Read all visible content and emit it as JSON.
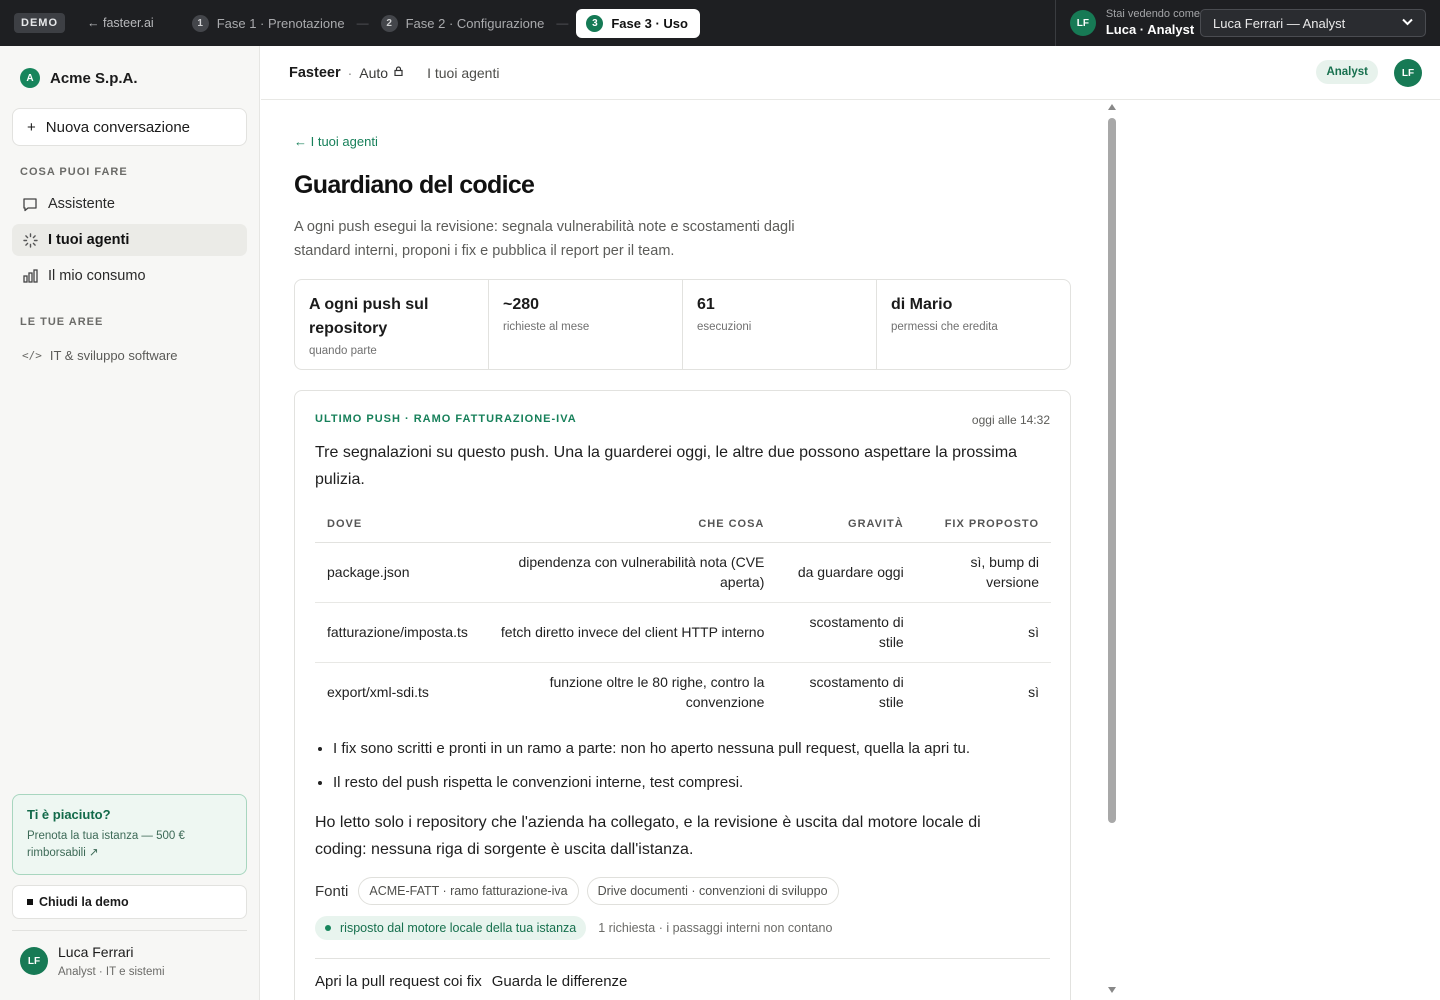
{
  "topbar": {
    "demo_badge": "DEMO",
    "back_link": "← fasteer.ai",
    "steps": [
      {
        "num": "1",
        "label": "Fase 1 · Prenotazione"
      },
      {
        "num": "2",
        "label": "Fase 2 · Configurazione"
      },
      {
        "num": "3",
        "label": "Fase 3 · Uso"
      }
    ],
    "separator": "—",
    "viewing_avatar": "LF",
    "viewing_line1": "Stai vedendo come",
    "viewing_line2": "Luca · Analyst",
    "user_select_value": "Luca Ferrari — Analyst"
  },
  "sidebar": {
    "org_initial": "A",
    "org_name": "Acme S.p.A.",
    "new_conversation": "Nuova conversazione",
    "section_what": "COSA PUOI FARE",
    "items": [
      {
        "label": "Assistente"
      },
      {
        "label": "I tuoi agenti"
      },
      {
        "label": "Il mio consumo"
      }
    ],
    "section_areas": "LE TUE AREE",
    "area_code": "</>",
    "area_label": "IT & sviluppo software",
    "promo_title": "Ti è piaciuto?",
    "promo_text": "Prenota la tua istanza — 500 € rimborsabili ↗",
    "close_demo": "Chiudi la demo",
    "user_initials": "LF",
    "user_name": "Luca Ferrari",
    "user_role": "Analyst · IT e sistemi"
  },
  "header": {
    "brand": "Fasteer",
    "dot": "·",
    "mode": "Auto",
    "link": "I tuoi agenti",
    "role_pill": "Analyst",
    "avatar": "LF"
  },
  "agent": {
    "back": "← I tuoi agenti",
    "title": "Guardiano del codice",
    "description": "A ogni push esegui la revisione: segnala vulnerabilità note e scostamenti dagli standard interni, proponi i fix e pubblica il report per il team.",
    "stats": [
      {
        "value": "A ogni push sul repository",
        "label": "quando parte"
      },
      {
        "value": "~280",
        "label": "richieste al mese"
      },
      {
        "value": "61",
        "label": "esecuzioni"
      },
      {
        "value": "di Mario",
        "label": "permessi che eredita"
      }
    ]
  },
  "report": {
    "label": "ULTIMO PUSH · RAMO FATTURAZIONE-IVA",
    "time": "oggi alle 14:32",
    "lead": "Tre segnalazioni su questo push. Una la guarderei oggi, le altre due possono aspettare la prossima pulizia.",
    "columns": [
      "DOVE",
      "CHE COSA",
      "GRAVITÀ",
      "FIX PROPOSTO"
    ],
    "rows": [
      [
        "package.json",
        "dipendenza con vulnerabilità nota (CVE aperta)",
        "da guardare oggi",
        "sì, bump di versione"
      ],
      [
        "fatturazione/imposta.ts",
        "fetch diretto invece del client HTTP interno",
        "scostamento di stile",
        "sì"
      ],
      [
        "export/xml-sdi.ts",
        "funzione oltre le 80 righe, contro la convenzione",
        "scostamento di stile",
        "sì"
      ]
    ],
    "bullets": [
      "I fix sono scritti e pronti in un ramo a parte: non ho aperto nessuna pull request, quella la apri tu.",
      "Il resto del push rispetta le convenzioni interne, test compresi."
    ],
    "note": "Ho letto solo i repository che l'azienda ha collegato, e la revisione è uscita dal motore locale di coding: nessuna riga di sorgente è uscita dall'istanza.",
    "sources_label": "Fonti",
    "sources": [
      "ACME-FATT · ramo fatturazione-iva",
      "Drive documenti · convenzioni di sviluppo"
    ],
    "engine": "risposto dal motore locale della tua istanza",
    "engine_note": "1 richiesta · i passaggi interni non contano",
    "action_primary": "Apri la pull request coi fix",
    "action_secondary": "Guarda le differenze"
  }
}
